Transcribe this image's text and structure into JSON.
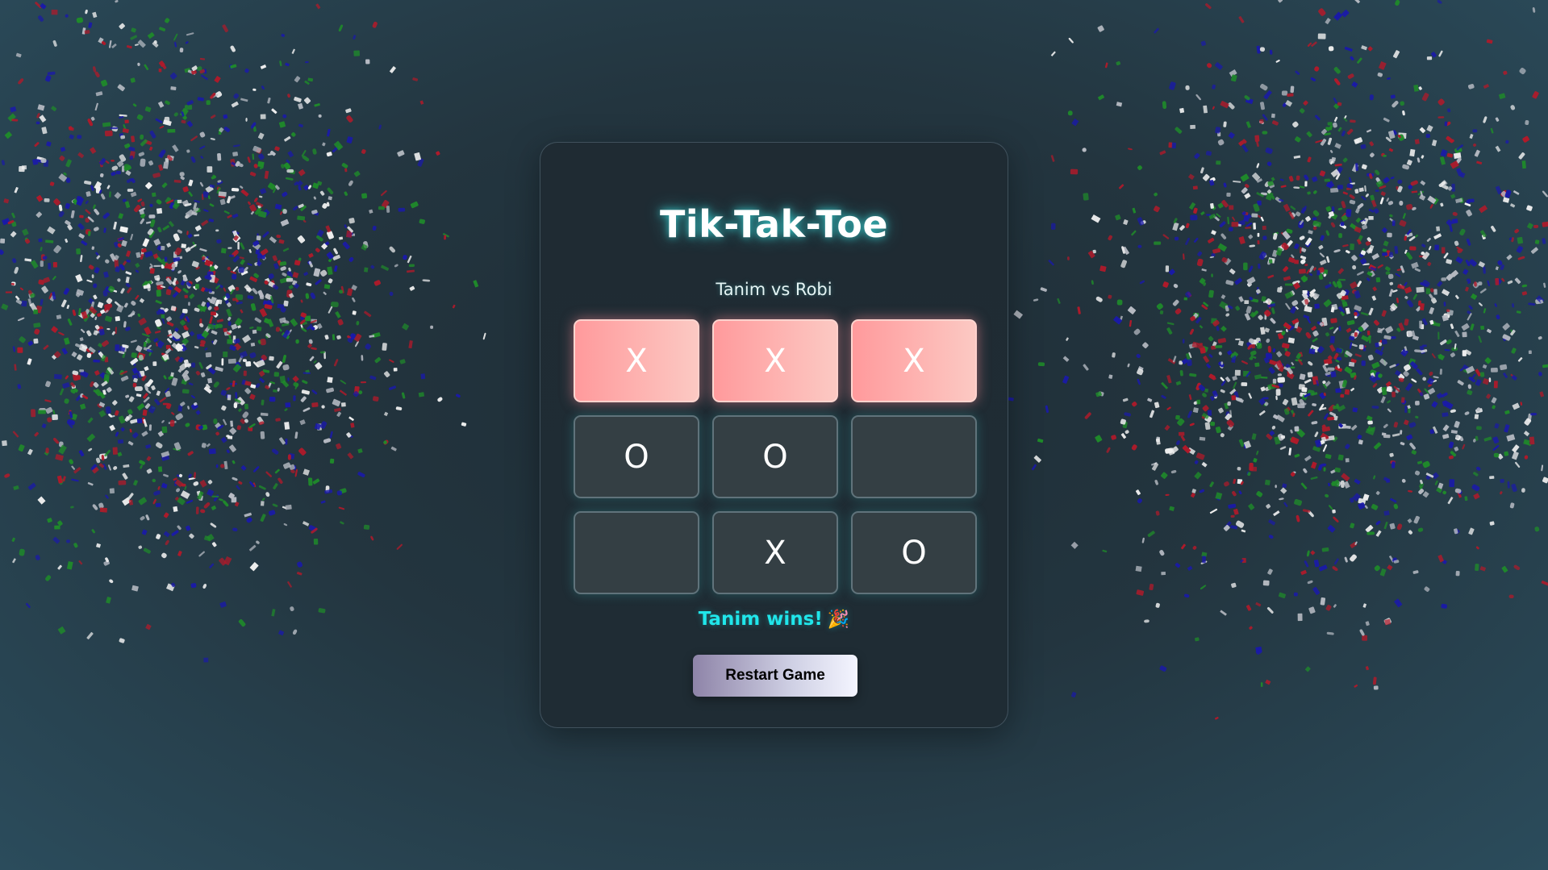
{
  "game": {
    "title": "Tik-Tak-Toe",
    "players": "Tanim vs Robi",
    "status": "Tanim wins!",
    "status_icon": "party-popper-icon",
    "restart_label": "Restart Game"
  },
  "board": {
    "cells": [
      {
        "value": "X",
        "winning": true
      },
      {
        "value": "X",
        "winning": true
      },
      {
        "value": "X",
        "winning": true
      },
      {
        "value": "O",
        "winning": false
      },
      {
        "value": "O",
        "winning": false
      },
      {
        "value": "",
        "winning": false
      },
      {
        "value": "",
        "winning": false
      },
      {
        "value": "X",
        "winning": false
      },
      {
        "value": "O",
        "winning": false
      }
    ]
  },
  "colors": {
    "accent_cyan": "#20e6ea",
    "win_cell_start": "#ff9a9c",
    "win_cell_end": "#fcc9c3",
    "confetti": [
      "#f0f0f0",
      "#1a1aa8",
      "#1f8a2a",
      "#b01a2a",
      "#b8bcc4"
    ]
  }
}
